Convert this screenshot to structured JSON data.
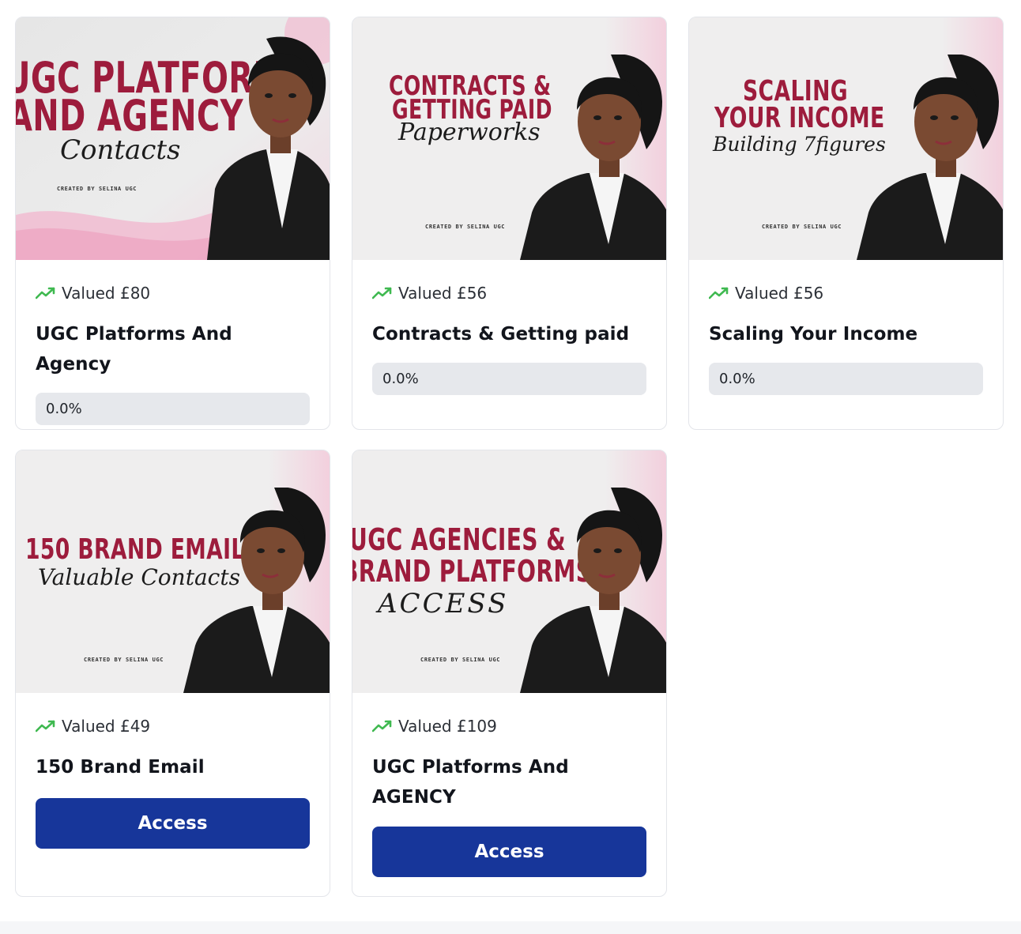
{
  "courses": [
    {
      "thumbnail": {
        "headline_1": "UGC PLATFORMS",
        "headline_2": "AND AGENCY",
        "script": "Contacts",
        "credit": "CREATED BY SELINA UGC"
      },
      "valued": "Valued £80",
      "title": "UGC Platforms And Agency",
      "progress": {
        "value": 0.0,
        "label": "0.0%"
      }
    },
    {
      "thumbnail": {
        "headline_1": "CONTRACTS &",
        "headline_2": "GETTING PAID",
        "script": "Paperworks",
        "credit": "CREATED BY SELINA UGC"
      },
      "valued": "Valued £56",
      "title": "Contracts & Getting paid",
      "progress": {
        "value": 0.0,
        "label": "0.0%"
      }
    },
    {
      "thumbnail": {
        "headline_1": "SCALING",
        "headline_2": "YOUR INCOME",
        "script": "Building 7figures",
        "credit": "CREATED BY SELINA UGC"
      },
      "valued": "Valued £56",
      "title": "Scaling Your Income",
      "progress": {
        "value": 0.0,
        "label": "0.0%"
      }
    },
    {
      "thumbnail": {
        "headline_1": "150 BRAND EMAIL",
        "script": "Valuable Contacts",
        "credit": "CREATED BY SELINA UGC"
      },
      "valued": "Valued £49",
      "title": "150 Brand Email",
      "action_label": "Access"
    },
    {
      "thumbnail": {
        "headline_1": "UGC AGENCIES &",
        "headline_2": "BRAND PLATFORMS",
        "script": "ACCESS",
        "credit": "CREATED BY SELINA UGC"
      },
      "valued": "Valued £109",
      "title": "UGC Platforms And AGENCY",
      "action_label": "Access"
    }
  ],
  "colors": {
    "accent_button": "#17369a",
    "trend_icon": "#3fb950",
    "thumbnail_headline": "#9d1c3c",
    "progress_track": "#e6e8ec"
  },
  "icons": {
    "valued": "trending-up-icon"
  }
}
